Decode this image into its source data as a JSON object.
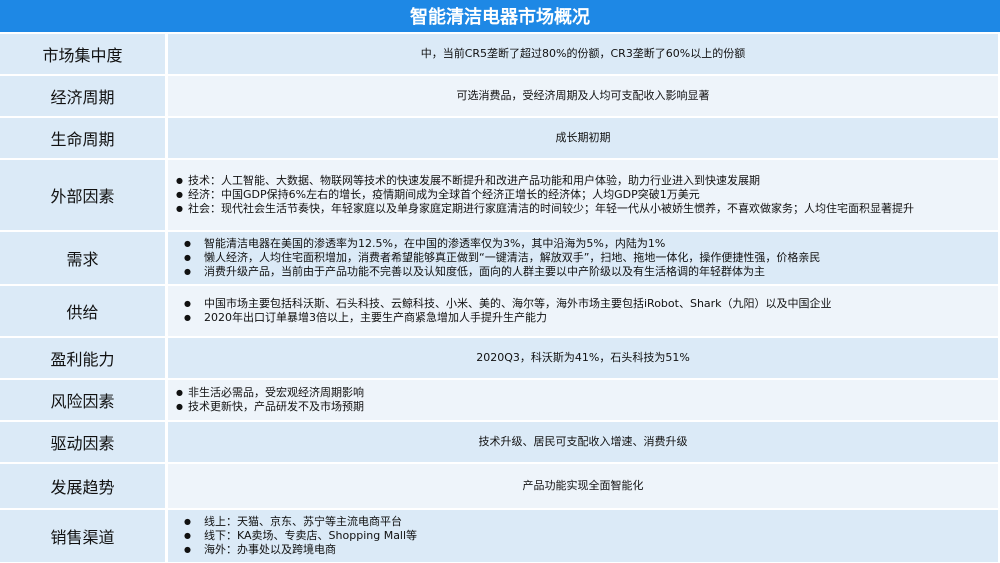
{
  "title": "智能清洁电器市场概况",
  "colors": {
    "header": "#1e88e5",
    "label_bg": "#dbeaf7",
    "row_alt": "#eef4fa"
  },
  "rows": [
    {
      "label": "市场集中度",
      "text": "中，当前CR5垄断了超过80%的份额，CR3垄断了60%以上的份额"
    },
    {
      "label": "经济周期",
      "text": "可选消费品，受经济周期及人均可支配收入影响显著"
    },
    {
      "label": "生命周期",
      "text": "成长期初期"
    },
    {
      "label": "外部因素",
      "items": [
        "技术：人工智能、大数据、物联网等技术的快速发展不断提升和改进产品功能和用户体验，助力行业进入到快速发展期",
        "经济：中国GDP保持6%左右的增长，疫情期间成为全球首个经济正增长的经济体；人均GDP突破1万美元",
        "社会：现代社会生活节奏快，年轻家庭以及单身家庭定期进行家庭清洁的时间较少；年轻一代从小被娇生惯养，不喜欢做家务；人均住宅面积显著提升"
      ]
    },
    {
      "label": "需求",
      "items": [
        "智能清洁电器在美国的渗透率为12.5%，在中国的渗透率仅为3%，其中沿海为5%，内陆为1%",
        "懒人经济，人均住宅面积增加，消费者希望能够真正做到“一键清洁，解放双手”，扫地、拖地一体化，操作便捷性强，价格亲民",
        "消费升级产品，当前由于产品功能不完善以及认知度低，面向的人群主要以中产阶级以及有生活格调的年轻群体为主"
      ]
    },
    {
      "label": "供给",
      "items": [
        "中国市场主要包括科沃斯、石头科技、云鲸科技、小米、美的、海尔等，海外市场主要包括iRobot、Shark（九阳）以及中国企业",
        "2020年出口订单暴增3倍以上，主要生产商紧急增加人手提升生产能力"
      ]
    },
    {
      "label": "盈利能力",
      "text": "2020Q3，科沃斯为41%，石头科技为51%"
    },
    {
      "label": "风险因素",
      "items": [
        "非生活必需品，受宏观经济周期影响",
        "技术更新快，产品研发不及市场预期"
      ]
    },
    {
      "label": "驱动因素",
      "text": "技术升级、居民可支配收入增速、消费升级"
    },
    {
      "label": "发展趋势",
      "text": "产品功能实现全面智能化"
    },
    {
      "label": "销售渠道",
      "items": [
        "线上：天猫、京东、苏宁等主流电商平台",
        "线下：KA卖场、专卖店、Shopping Mall等",
        "海外：办事处以及跨境电商"
      ]
    }
  ]
}
